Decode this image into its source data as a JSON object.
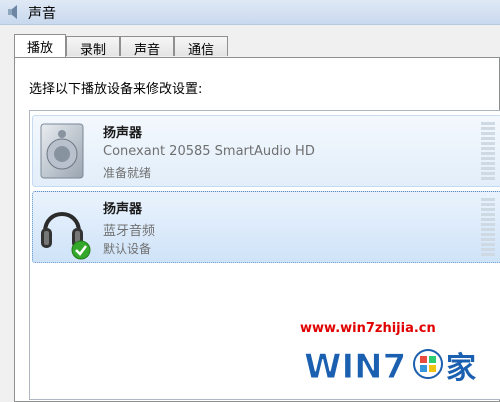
{
  "window": {
    "title": "声音"
  },
  "tabs": [
    {
      "label": "播放",
      "active": true
    },
    {
      "label": "录制"
    },
    {
      "label": "声音"
    },
    {
      "label": "通信"
    }
  ],
  "instruction": "选择以下播放设备来修改设置:",
  "devices": [
    {
      "icon": "speaker-icon",
      "name": "扬声器",
      "description": "Conexant 20585 SmartAudio HD",
      "status": "准备就绪"
    },
    {
      "icon": "headphones-icon",
      "name": "扬声器",
      "description": "蓝牙音频",
      "status": "默认设备",
      "default_badge": "green-check-icon"
    }
  ],
  "watermark": {
    "url": "www.win7zhijia.cn",
    "logo_text": "Win7之家",
    "url_color": "#e00000"
  },
  "colors": {
    "selection_background": "#cfe3f8",
    "selection_border": "#5c8fc9",
    "status_text": "#707070"
  }
}
